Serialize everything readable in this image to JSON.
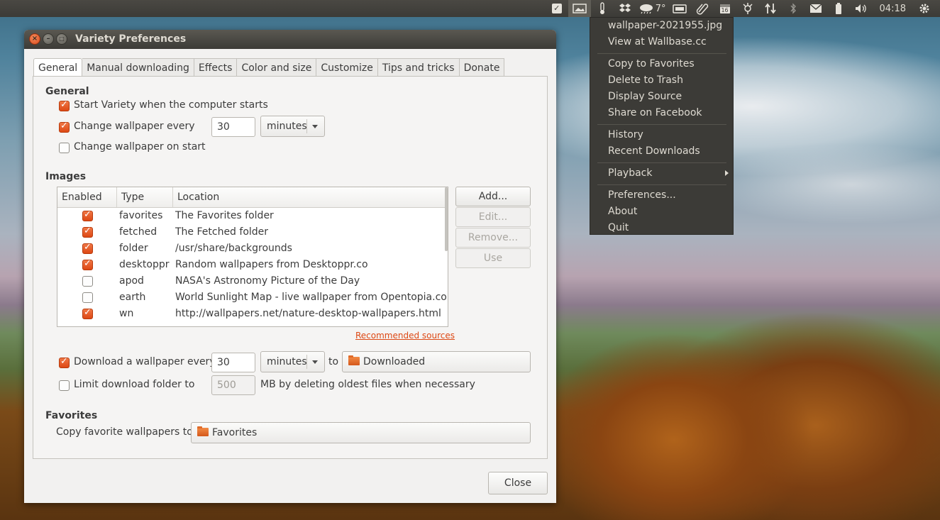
{
  "topbar": {
    "weather_temp": "7°",
    "clock": "04:18",
    "calendar_day": "16",
    "icons": [
      "check-icon",
      "variety-icon",
      "thermometer-icon",
      "dropbox-icon",
      "weather-icon",
      "disk-icon",
      "paperclip-icon",
      "calendar-icon",
      "usb-icon",
      "network-icon",
      "bluetooth-icon",
      "mail-icon",
      "battery-icon",
      "volume-icon",
      "gear-icon"
    ]
  },
  "menu": {
    "items": [
      {
        "label": "wallpaper-2021955.jpg"
      },
      {
        "label": "View at Wallbase.cc"
      },
      {
        "label": "Copy to Favorites"
      },
      {
        "label": "Delete to Trash"
      },
      {
        "label": "Display Source"
      },
      {
        "label": "Share on Facebook"
      },
      {
        "label": "History"
      },
      {
        "label": "Recent Downloads"
      },
      {
        "label": "Playback"
      },
      {
        "label": "Preferences..."
      },
      {
        "label": "About"
      },
      {
        "label": "Quit"
      }
    ]
  },
  "window": {
    "title": "Variety Preferences",
    "tabs": [
      "General",
      "Manual downloading",
      "Effects",
      "Color and size",
      "Customize",
      "Tips and tricks",
      "Donate"
    ],
    "active_tab": "General",
    "general": {
      "heading": "General",
      "start_on_boot": {
        "label": "Start Variety when the computer starts",
        "checked": true
      },
      "change_every": {
        "label": "Change wallpaper every",
        "checked": true,
        "value": "30",
        "unit": "minutes"
      },
      "change_on_start": {
        "label": "Change wallpaper on start",
        "checked": false
      }
    },
    "images": {
      "heading": "Images",
      "columns": [
        "Enabled",
        "Type",
        "Location"
      ],
      "rows": [
        {
          "enabled": true,
          "type": "favorites",
          "location": "The Favorites folder"
        },
        {
          "enabled": true,
          "type": "fetched",
          "location": "The Fetched folder"
        },
        {
          "enabled": true,
          "type": "folder",
          "location": "/usr/share/backgrounds"
        },
        {
          "enabled": true,
          "type": "desktoppr",
          "location": "Random wallpapers from Desktoppr.co"
        },
        {
          "enabled": false,
          "type": "apod",
          "location": "NASA's Astronomy Picture of the Day"
        },
        {
          "enabled": false,
          "type": "earth",
          "location": "World Sunlight Map - live wallpaper from Opentopia.com"
        },
        {
          "enabled": true,
          "type": "wn",
          "location": "http://wallpapers.net/nature-desktop-wallpapers.html"
        }
      ],
      "buttons": {
        "add": "Add...",
        "edit": "Edit...",
        "remove": "Remove...",
        "use": "Use"
      },
      "recommended_link": "Recommended sources"
    },
    "download": {
      "label": "Download a wallpaper every",
      "checked": true,
      "value": "30",
      "unit": "minutes",
      "to_label": "to",
      "folder": "Downloaded"
    },
    "limit": {
      "label": "Limit download folder to",
      "checked": false,
      "value": "500",
      "suffix": "MB by deleting oldest files when necessary"
    },
    "favorites": {
      "heading": "Favorites",
      "label": "Copy favorite wallpapers to",
      "folder": "Favorites"
    },
    "close_label": "Close"
  },
  "colors": {
    "accent": "#dd4814",
    "panel": "#3c3b37"
  }
}
